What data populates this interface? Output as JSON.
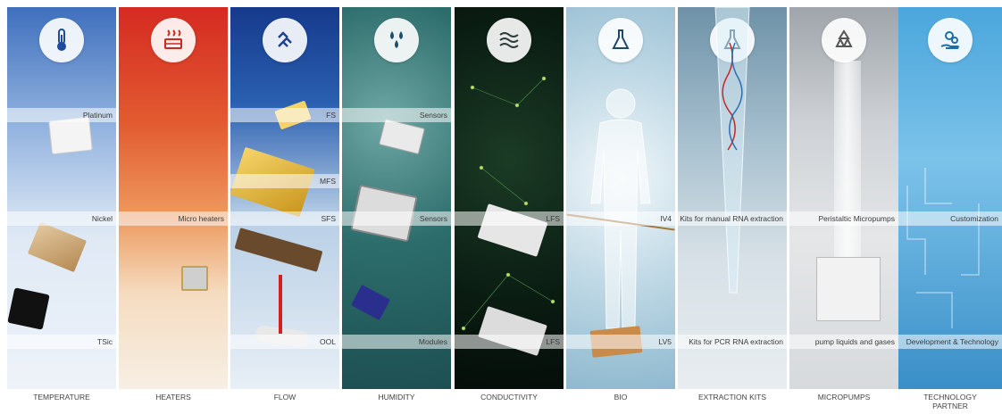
{
  "panels": [
    {
      "category": "TEMPERATURE",
      "icon": "thermometer-icon",
      "tags": [
        "Platinum",
        "Nickel",
        "TSic"
      ],
      "colors": [
        "#6a8cc8",
        "#e8eef7"
      ]
    },
    {
      "category": "HEATERS",
      "icon": "heater-icon",
      "tags": [
        "Micro heaters"
      ],
      "colors": [
        "#d93a22",
        "#f2e3cf"
      ]
    },
    {
      "category": "FLOW",
      "icon": "flow-arrows-icon",
      "tags": [
        "FS",
        "MFS",
        "SFS",
        "OOL"
      ],
      "colors": [
        "#1a3d8f",
        "#d8e6f2"
      ]
    },
    {
      "category": "HUMIDITY",
      "icon": "droplets-icon",
      "tags": [
        "Sensors",
        "Sensors",
        "Modules"
      ],
      "colors": [
        "#1f6b6a",
        "#6f9ea0"
      ]
    },
    {
      "category": "CONDUCTIVITY",
      "icon": "waves-icon",
      "tags": [
        "LFS",
        "LFS"
      ],
      "colors": [
        "#06150e",
        "#1d4a2a"
      ]
    },
    {
      "category": "BIO",
      "icon": "flask-icon",
      "tags": [
        "IV4",
        "LV5"
      ],
      "colors": [
        "#b5d5e6",
        "#dce9f0"
      ]
    },
    {
      "category": "EXTRACTION KITS",
      "icon": "flask-icon",
      "tags": [
        "Kits for manual RNA extraction",
        "Kits for PCR RNA extraction"
      ],
      "colors": [
        "#7aa0b5",
        "#dfe6ea"
      ]
    },
    {
      "category": "MICROPUMPS",
      "icon": "recycle-icon",
      "tags": [
        "Peristaltic Micropumps",
        "pump liquids and gases"
      ],
      "colors": [
        "#c9ccd1",
        "#e9eaec"
      ]
    },
    {
      "category": "TECHNOLOGY PARTNER",
      "icon": "gears-hand-icon",
      "tags": [
        "Customization",
        "Development & Technology"
      ],
      "colors": [
        "#3e9fd6",
        "#9fd0ef"
      ]
    }
  ]
}
